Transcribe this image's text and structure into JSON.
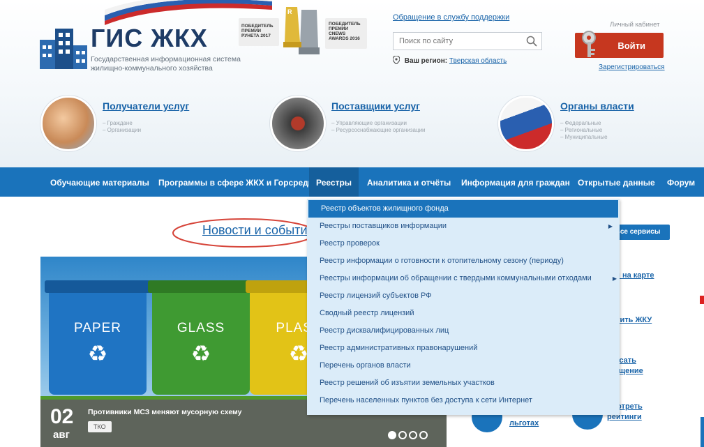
{
  "header": {
    "logo_title": "ГИС ЖКХ",
    "logo_subtitle": "Государственная информационная система жилищно-коммунального хозяйства",
    "award1": "ПОБЕДИТЕЛЬ ПРЕМИИ РУНЕТА 2017",
    "award2": "ПОБЕДИТЕЛЬ ПРЕМИИ CNEWS AWARDS 2016",
    "support_link": "Обращение в службу поддержки",
    "search_placeholder": "Поиск по сайту",
    "region_label": "Ваш регион:",
    "region_value": "Тверская область",
    "cabinet_label": "Личный кабинет",
    "login_label": "Войти",
    "register_link": "Зарегистрироваться"
  },
  "audiences": [
    {
      "title": "Получатели услуг",
      "sub": [
        "– Граждане",
        "– Организации"
      ]
    },
    {
      "title": "Поставщики услуг",
      "sub": [
        "– Управляющие организации",
        "– Ресурсоснабжающие организации"
      ]
    },
    {
      "title": "Органы власти",
      "sub": [
        "– Федеральные",
        "– Региональные",
        "– Муниципальные"
      ]
    }
  ],
  "nav": [
    {
      "label": "Обучающие материалы"
    },
    {
      "label": "Программы в сфере ЖКХ и Горсреды"
    },
    {
      "label": "Реестры",
      "active": true
    },
    {
      "label": "Аналитика и отчёты"
    },
    {
      "label": "Информация для граждан"
    },
    {
      "label": "Открытые данные"
    },
    {
      "label": "Форум"
    }
  ],
  "dropdown": [
    {
      "label": "Реестр объектов жилищного фонда",
      "highlighted": true
    },
    {
      "label": "Реестры поставщиков информации",
      "submenu": true
    },
    {
      "label": "Реестр проверок"
    },
    {
      "label": "Реестр информации о готовности к отопительному сезону (периоду)"
    },
    {
      "label": "Реестры информации об обращении с твердыми коммунальными отходами",
      "submenu": true
    },
    {
      "label": "Реестр лицензий субъектов РФ"
    },
    {
      "label": "Сводный реестр лицензий"
    },
    {
      "label": "Реестр дисквалифицированных лиц"
    },
    {
      "label": "Реестр административных правонарушений"
    },
    {
      "label": "Перечень органов власти"
    },
    {
      "label": "Реестр решений об изъятии земельных участков"
    },
    {
      "label": "Перечень населенных пунктов без доступа к сети Интернет"
    }
  ],
  "main": {
    "news_title": "Новости и событи",
    "all_services": "Все сервисы"
  },
  "slide": {
    "bins": [
      "PAPER",
      "GLASS",
      "PLAST"
    ],
    "day": "02",
    "month": "авг",
    "title": "Противники МСЗ меняют мусорную схему",
    "tag": "ТКО",
    "dots_active": 1,
    "dots_total": 4
  },
  "side_links": [
    "йти на карте",
    "латить ЖКУ",
    "писать",
    "ращение",
    "смотреть",
    "рейтинги",
    "льготах"
  ],
  "colors": {
    "nav_blue": "#1a73bb",
    "login_red": "#c6371f",
    "link_blue": "#1863a8",
    "dropdown_bg": "#dbecf9"
  },
  "icons": [
    "search-icon",
    "location-pin-icon",
    "keys-icon",
    "recycle-icon",
    "chevron-right-icon"
  ]
}
